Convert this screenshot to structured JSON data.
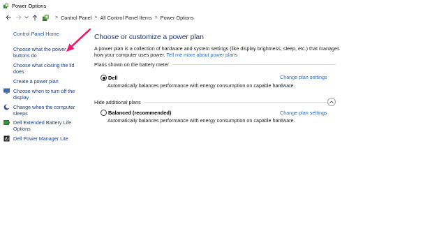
{
  "window": {
    "title": "Power Options",
    "title_icon": "power-options-icon"
  },
  "addressbar": {
    "back_icon": "back-arrow-icon",
    "forward_icon": "forward-arrow-icon",
    "recent_icon": "chevron-down-icon",
    "up_icon": "up-arrow-icon",
    "location_icon": "control-panel-icon",
    "breadcrumbs": [
      "Control Panel",
      "All Control Panel Items",
      "Power Options"
    ],
    "separator": ">"
  },
  "sidebar": {
    "home_label": "Control Panel Home",
    "items": [
      {
        "label": "Choose what the power buttons do",
        "icon": ""
      },
      {
        "label": "Choose what closing the lid does",
        "icon": ""
      },
      {
        "label": "Create a power plan",
        "icon": ""
      },
      {
        "label": "Choose when to turn off the display",
        "icon": "display-shield-icon"
      },
      {
        "label": "Change when the computer sleeps",
        "icon": "sleep-moon-icon"
      },
      {
        "label": "Dell Extended Battery Life Options",
        "icon": "dell-battery-icon"
      },
      {
        "label": "Dell Power Manager Lite",
        "icon": "dell-power-manager-icon"
      }
    ]
  },
  "main": {
    "heading": "Choose or customize a power plan",
    "description": "A power plan is a collection of hardware and system settings (like display brightness, sleep, etc.) that manages how your computer uses power.",
    "description_link": "Tell me more about power plans",
    "battery_meter_group": "Plans shown on the battery meter",
    "additional_group": "Hide additional plans",
    "collapse_icon": "chevron-up-circle-icon",
    "plans": [
      {
        "name": "Dell",
        "selected": true,
        "description": "Automatically balances performance with energy consumption on capable hardware.",
        "change_link": "Change plan settings"
      },
      {
        "name": "Balanced (recommended)",
        "selected": false,
        "description": "Automatically balances performance with energy consumption on capable hardware.",
        "change_link": "Change plan settings"
      }
    ]
  },
  "annotation": {
    "icon": "pink-pointer-arrow-icon",
    "color": "#ee1c6a"
  },
  "colors": {
    "link": "#2b6cc4",
    "heading": "#1e3278",
    "sidebar_link": "#1e3f8a"
  }
}
